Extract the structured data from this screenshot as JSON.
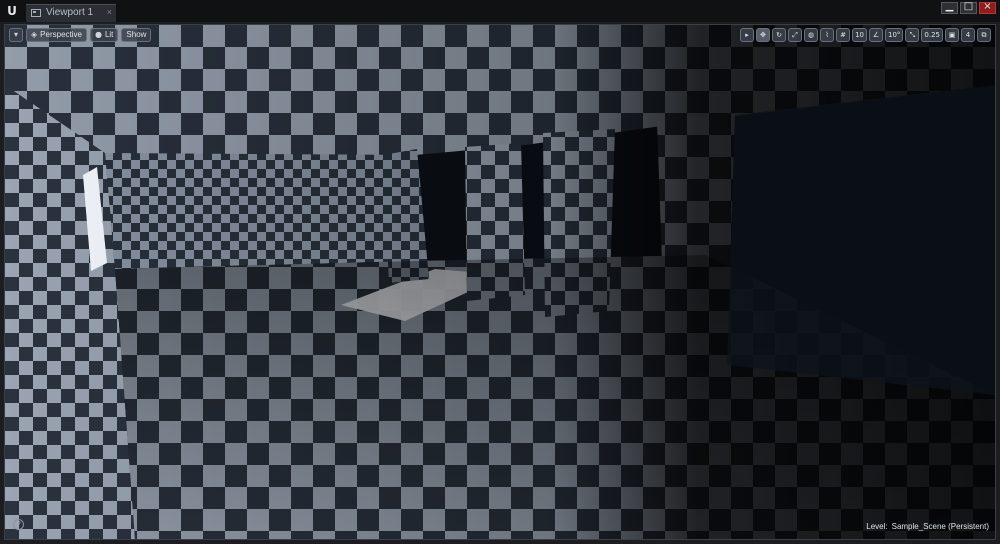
{
  "app": {
    "logo": "U"
  },
  "tab": {
    "label": "Viewport 1",
    "close": "×"
  },
  "window_controls": {
    "minimize": "▁",
    "maximize": "□",
    "close": "×"
  },
  "viewport_toolbar": {
    "menu_glyph": "▾",
    "perspective_label": "Perspective",
    "lit_label": "Lit",
    "show_label": "Show"
  },
  "right_toolbar": {
    "grid_snap_value": "10",
    "rotation_snap_value": "10°",
    "scale_snap_value": "0.25",
    "camera_speed_value": "4"
  },
  "status": {
    "level_label": "Level:",
    "level_name": "Sample_Scene (Persistent)"
  },
  "help": {
    "glyph": "?"
  },
  "colors": {
    "checker_light": "#9aa4b2",
    "checker_dark": "#2a323e",
    "window_light": "#f4f8ff",
    "shadow": "#0b1017"
  }
}
